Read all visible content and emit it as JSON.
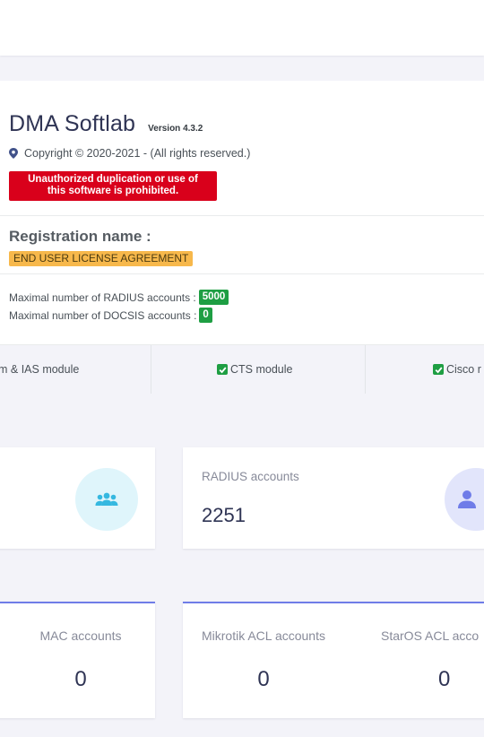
{
  "app": {
    "title": "DMA Softlab",
    "version": "Version 4.3.2",
    "copyright": "Copyright © 2020-2021 - (All rights reserved.)",
    "warning_line1": "Unauthorized duplication or use of",
    "warning_line2": "this software is prohibited."
  },
  "registration": {
    "label": "Registration name :",
    "name": "END USER LICENSE AGREEMENT"
  },
  "limits": {
    "radius_label": "Maximal number of RADIUS accounts :",
    "radius_value": "5000",
    "docsis_label": "Maximal number of DOCSIS accounts :",
    "docsis_value": "0"
  },
  "modules": [
    {
      "label": "m & IAS module"
    },
    {
      "label": "CTS module"
    },
    {
      "label": "Cisco r"
    }
  ],
  "stats": {
    "radius_accounts_label": "RADIUS accounts",
    "radius_accounts_value": "2251"
  },
  "account_types": [
    {
      "label": "MAC accounts",
      "value": "0"
    },
    {
      "label": "Mikrotik ACL accounts",
      "value": "0"
    },
    {
      "label": "StarOS ACL acco",
      "value": "0"
    }
  ],
  "colors": {
    "warning": "#d9001b",
    "eula": "#f7b84b",
    "success": "#1e9e43",
    "accent": "#6f7ce8",
    "icon_users_bg": "#dff5fb",
    "icon_users_fg": "#35b8e0",
    "icon_user_bg": "#e2e5fb",
    "icon_user_fg": "#6f7ce8"
  },
  "icons": [
    "map-pin-icon",
    "check-icon",
    "users-icon",
    "user-icon"
  ]
}
